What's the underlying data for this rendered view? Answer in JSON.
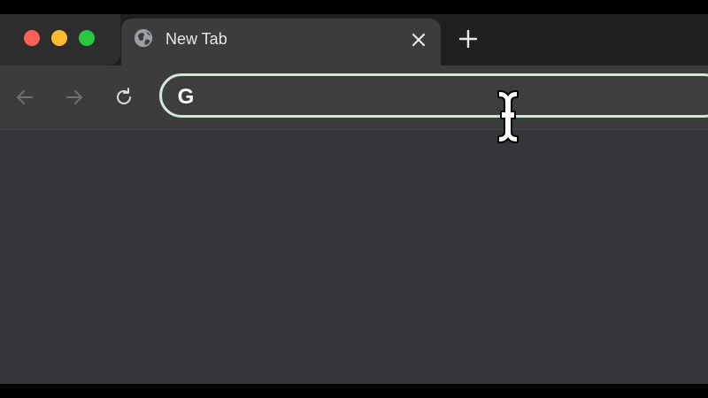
{
  "tab": {
    "title": "New Tab",
    "icon": "globe-icon"
  },
  "toolbar": {
    "back_icon": "arrow-left-icon",
    "forward_icon": "arrow-right-icon",
    "reload_icon": "reload-icon"
  },
  "omnibox": {
    "icon": "google-g-icon",
    "value": "",
    "placeholder": ""
  },
  "colors": {
    "close": "#fe5f57",
    "minimize": "#febc2e",
    "maximize": "#28c840",
    "omnibox_focus_ring": "#cfe8d5",
    "content_bg": "#36353b"
  }
}
